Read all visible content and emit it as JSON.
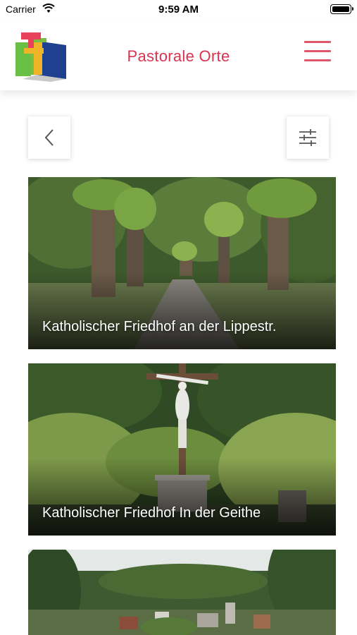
{
  "status_bar": {
    "carrier": "Carrier",
    "time": "9:59 AM"
  },
  "header": {
    "title": "Pastorale Orte",
    "logo_icon": "church-cross-logo-icon",
    "menu_icon": "hamburger-menu-icon"
  },
  "toolbar": {
    "back_icon": "chevron-left-icon",
    "filter_icon": "sliders-filter-icon"
  },
  "places": [
    {
      "name": "Katholischer Friedhof an der Lippestr."
    },
    {
      "name": "Katholischer Friedhof In der Geithe"
    },
    {
      "name": ""
    }
  ],
  "colors": {
    "accent": "#d8344f",
    "menu": "#e0566b"
  }
}
